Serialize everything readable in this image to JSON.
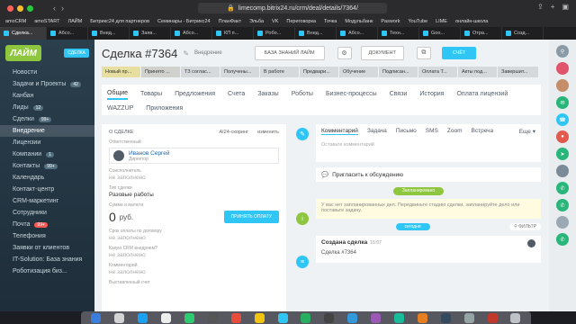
{
  "browser": {
    "url": "limecomp.bitrix24.ru/crm/deal/details/7364/",
    "bookmarks": [
      "amoCRM",
      "amoSTART",
      "ЛАЙМ",
      "Битрикс24 для партнеров",
      "Семинары - Битрикс24",
      "ПланФакт",
      "Эльба",
      "VK",
      "Переговорка",
      "Точка",
      "Модульбанк",
      "Paswork",
      "YouTube",
      "LIME",
      "онлайн-школа"
    ],
    "tabs": [
      {
        "label": "Сделка...",
        "active": true
      },
      {
        "label": "Абсо..."
      },
      {
        "label": "Внед..."
      },
      {
        "label": "Заяв..."
      },
      {
        "label": "Абсо..."
      },
      {
        "label": "КП п..."
      },
      {
        "label": "Робо..."
      },
      {
        "label": "Внед..."
      },
      {
        "label": "Абсо..."
      },
      {
        "label": "Техн..."
      },
      {
        "label": "Goo..."
      },
      {
        "label": "Отра..."
      },
      {
        "label": "Созд..."
      }
    ]
  },
  "sidebar": {
    "logo_text": "ЛАЙМ",
    "logo_button": "СДЕЛКА",
    "items": [
      {
        "label": "Новости"
      },
      {
        "label": "Задачи и Проекты",
        "count": "42"
      },
      {
        "label": "Канбан"
      },
      {
        "label": "Лиды",
        "count": "12"
      },
      {
        "label": "Сделки",
        "count": "99+"
      },
      {
        "label": "Внедрение",
        "active": true
      },
      {
        "label": "Лицензии"
      },
      {
        "label": "Компании",
        "count": "1"
      },
      {
        "label": "Контакты",
        "count": "99+"
      },
      {
        "label": "Календарь"
      },
      {
        "label": "Контакт-центр"
      },
      {
        "label": "CRM-маркетинг"
      },
      {
        "label": "Сотрудники"
      },
      {
        "label": "Почта",
        "count": "99+",
        "red": true
      },
      {
        "label": "Телефония"
      },
      {
        "label": "Заявки от клиентов"
      },
      {
        "label": "IT-Solution: База знания"
      },
      {
        "label": "Роботизация биз..."
      }
    ]
  },
  "deal": {
    "title": "Сделка #7364",
    "category": "Внедрение",
    "kb_button": "БАЗА ЗНАНИЙ ЛАЙМ",
    "doc_button": "ДОКУМЕНТ",
    "account_button": "СЧЁТ",
    "stages": [
      {
        "label": "Новый пр...",
        "kind": "done"
      },
      {
        "label": "Принято ...",
        "kind": "cur"
      },
      {
        "label": "ТЗ соглас...",
        "kind": "rest"
      },
      {
        "label": "Получены...",
        "kind": "rest"
      },
      {
        "label": "В работе",
        "kind": "rest"
      },
      {
        "label": "Предвари...",
        "kind": "rest"
      },
      {
        "label": "Обучение",
        "kind": "rest"
      },
      {
        "label": "Подписан...",
        "kind": "rest"
      },
      {
        "label": "Оплата Т...",
        "kind": "rest"
      },
      {
        "label": "Акты под...",
        "kind": "rest"
      },
      {
        "label": "Завершит...",
        "kind": "fin"
      }
    ],
    "tabs": [
      "Общие",
      "Товары",
      "Предложения",
      "Счета",
      "Заказы",
      "Роботы",
      "Бизнес-процессы",
      "Связи",
      "История",
      "Оплата лицензий",
      "WAZZUP",
      "Приложения"
    ]
  },
  "card": {
    "header": "О СДЕЛКЕ",
    "ai_label": "AI24-скоринг",
    "change_label": "изменить",
    "responsible_label": "Ответственный",
    "person_name": "Иванов Сергей",
    "person_position": "Директор",
    "co_label": "Соисполнитель",
    "empty_value": "не заполнено",
    "type_label": "Тип сделки",
    "type_value": "Разовые работы",
    "amount_label": "Сумма и валюта",
    "amount": "0",
    "currency": "руб.",
    "pay_button": "ПРИНЯТЬ ОПЛАТУ",
    "contract_label": "Срок оплаты по договору",
    "crm_label": "Какую CRM внедряем?",
    "comment_label": "Комментарий",
    "invoice_label": "Выставленный счет"
  },
  "timeline": {
    "tabs": [
      "Комментарий",
      "Задача",
      "Письмо",
      "SMS",
      "Zoom",
      "Встреча"
    ],
    "more": "Еще",
    "placeholder": "Оставьте комментарий",
    "invite": "Пригласить к обсуждению",
    "planned_pill": "Запланировано",
    "plan_text": "У вас нет запланированных дел. Передвиньте стадию сделки, запланируйте дело или поставьте задачу.",
    "today_pill": "сегодня",
    "filter": "ФИЛЬТР",
    "event_title": "Создана сделка",
    "event_time": "15:07",
    "event_body": "Сделка #7364"
  },
  "colors": {
    "accent": "#2fc6f6",
    "sidebar": "#2b3f4d",
    "stage_done": "#e7df9f",
    "green": "#8ec63f"
  }
}
